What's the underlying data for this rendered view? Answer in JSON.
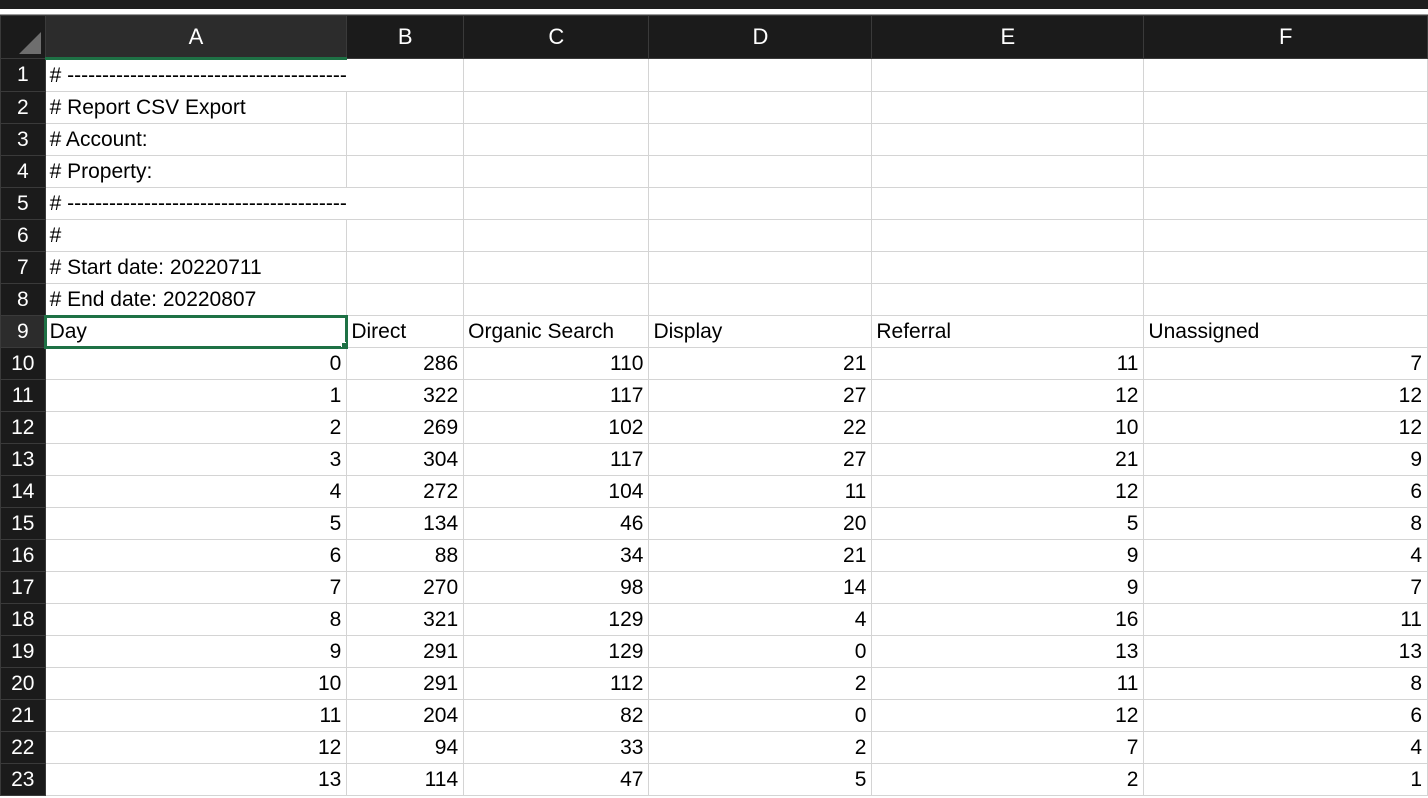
{
  "columns": [
    "A",
    "B",
    "C",
    "D",
    "E",
    "F"
  ],
  "selected_cell": "A9",
  "metadata_rows": [
    {
      "row": "1",
      "text": "# ----------------------------------------"
    },
    {
      "row": "2",
      "text": "# Report CSV Export"
    },
    {
      "row": "3",
      "text": "# Account:"
    },
    {
      "row": "4",
      "text": "# Property:"
    },
    {
      "row": "5",
      "text": "# ----------------------------------------"
    },
    {
      "row": "6",
      "text": "#"
    },
    {
      "row": "7",
      "text": "# Start date: 20220711"
    },
    {
      "row": "8",
      "text": "# End date: 20220807"
    }
  ],
  "header_row": {
    "row": "9",
    "cells": [
      "Day",
      "Direct",
      "Organic Search",
      "Display",
      "Referral",
      "Unassigned"
    ]
  },
  "data_rows": [
    {
      "row": "10",
      "cells": [
        "0",
        "286",
        "110",
        "21",
        "11",
        "7"
      ]
    },
    {
      "row": "11",
      "cells": [
        "1",
        "322",
        "117",
        "27",
        "12",
        "12"
      ]
    },
    {
      "row": "12",
      "cells": [
        "2",
        "269",
        "102",
        "22",
        "10",
        "12"
      ]
    },
    {
      "row": "13",
      "cells": [
        "3",
        "304",
        "117",
        "27",
        "21",
        "9"
      ]
    },
    {
      "row": "14",
      "cells": [
        "4",
        "272",
        "104",
        "11",
        "12",
        "6"
      ]
    },
    {
      "row": "15",
      "cells": [
        "5",
        "134",
        "46",
        "20",
        "5",
        "8"
      ]
    },
    {
      "row": "16",
      "cells": [
        "6",
        "88",
        "34",
        "21",
        "9",
        "4"
      ]
    },
    {
      "row": "17",
      "cells": [
        "7",
        "270",
        "98",
        "14",
        "9",
        "7"
      ]
    },
    {
      "row": "18",
      "cells": [
        "8",
        "321",
        "129",
        "4",
        "16",
        "11"
      ]
    },
    {
      "row": "19",
      "cells": [
        "9",
        "291",
        "129",
        "0",
        "13",
        "13"
      ]
    },
    {
      "row": "20",
      "cells": [
        "10",
        "291",
        "112",
        "2",
        "11",
        "8"
      ]
    },
    {
      "row": "21",
      "cells": [
        "11",
        "204",
        "82",
        "0",
        "12",
        "6"
      ]
    },
    {
      "row": "22",
      "cells": [
        "12",
        "94",
        "33",
        "2",
        "7",
        "4"
      ]
    },
    {
      "row": "23",
      "cells": [
        "13",
        "114",
        "47",
        "5",
        "2",
        "1"
      ]
    }
  ],
  "colors": {
    "header_bg": "#1b1b1b",
    "selection": "#1e7145",
    "gridline": "#d4d4d4"
  }
}
